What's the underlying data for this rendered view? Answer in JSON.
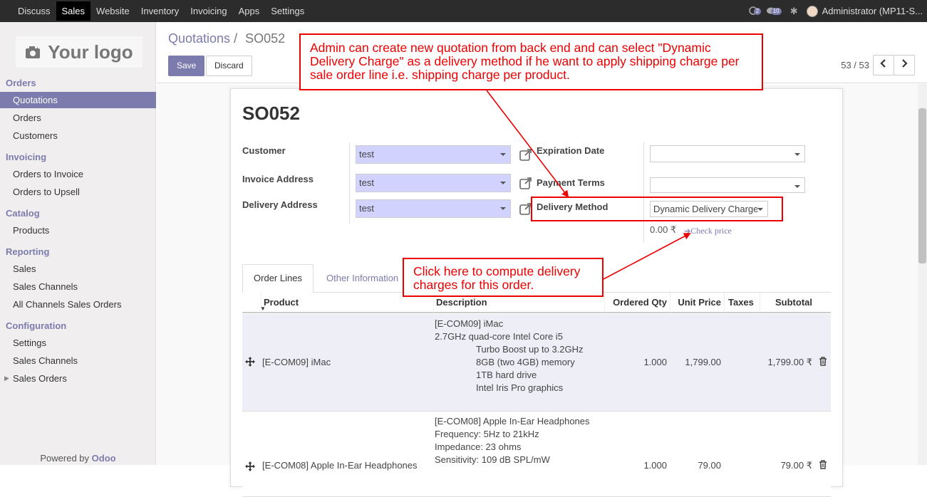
{
  "topbar": {
    "menu": [
      "Discuss",
      "Sales",
      "Website",
      "Inventory",
      "Invoicing",
      "Apps",
      "Settings"
    ],
    "active": "Sales",
    "chat_count": "2",
    "activity_count": "10",
    "user": "Administrator (MP11-S..."
  },
  "sidebar": {
    "logo_text": "Your logo",
    "sections": [
      {
        "title": "Orders",
        "items": [
          "Quotations",
          "Orders",
          "Customers"
        ]
      },
      {
        "title": "Invoicing",
        "items": [
          "Orders to Invoice",
          "Orders to Upsell"
        ]
      },
      {
        "title": "Catalog",
        "items": [
          "Products"
        ]
      },
      {
        "title": "Reporting",
        "items": [
          "Sales",
          "Sales Channels",
          "All Channels Sales Orders"
        ]
      },
      {
        "title": "Configuration",
        "items": [
          "Settings",
          "Sales Channels",
          "Sales Orders"
        ]
      }
    ],
    "active_item": "Quotations",
    "powered_prefix": "Powered by",
    "powered_brand": "Odoo"
  },
  "control_panel": {
    "breadcrumb_parent": "Quotations",
    "breadcrumb_sep": "/",
    "breadcrumb_current": "SO052",
    "save_label": "Save",
    "discard_label": "Discard",
    "pager": "53 / 53"
  },
  "form": {
    "order_name": "SO052",
    "customer_label": "Customer",
    "customer_value": "test",
    "invoice_address_label": "Invoice Address",
    "invoice_address_value": "test",
    "delivery_address_label": "Delivery Address",
    "delivery_address_value": "test",
    "expiration_date_label": "Expiration Date",
    "expiration_date_value": "",
    "payment_terms_label": "Payment Terms",
    "payment_terms_value": "",
    "delivery_method_label": "Delivery Method",
    "delivery_method_value": "Dynamic Delivery Charge",
    "delivery_price": "0.00 ₹",
    "check_price_label": "Check price"
  },
  "tabs": {
    "order_lines": "Order Lines",
    "other_information": "Other Information"
  },
  "table": {
    "headers": {
      "product": "Product",
      "description": "Description",
      "ordered_qty": "Ordered Qty",
      "unit_price": "Unit Price",
      "taxes": "Taxes",
      "subtotal": "Subtotal"
    },
    "rows": [
      {
        "product": "[E-COM09] iMac",
        "description": [
          "[E-COM09] iMac",
          "2.7GHz quad-core Intel Core i5",
          "Turbo Boost up to 3.2GHz",
          "8GB (two 4GB) memory",
          "1TB hard drive",
          "Intel Iris Pro graphics"
        ],
        "qty": "1.000",
        "unit_price": "1,799.00",
        "taxes": "",
        "subtotal": "1,799.00 ₹"
      },
      {
        "product": "[E-COM08] Apple In-Ear Headphones",
        "description": [
          "[E-COM08] Apple In-Ear Headphones",
          "Frequency: 5Hz to 21kHz",
          "Impedance: 23 ohms",
          "Sensitivity: 109 dB SPL/mW"
        ],
        "qty": "1.000",
        "unit_price": "79.00",
        "taxes": "",
        "subtotal": "79.00 ₹"
      }
    ]
  },
  "annotations": {
    "top_callout": "Admin can create new quotation from back end and can select \"Dynamic Delivery Charge\" as a delivery method if he want to apply shipping charge per sale order line i.e. shipping charge per product.",
    "bottom_callout": "Click here to compute delivery charges for this order.",
    "color": "#ee0000"
  },
  "colors": {
    "brand": "#7c7bad",
    "topbar": "#2c2c2c",
    "required_field": "#d2d2ff"
  }
}
